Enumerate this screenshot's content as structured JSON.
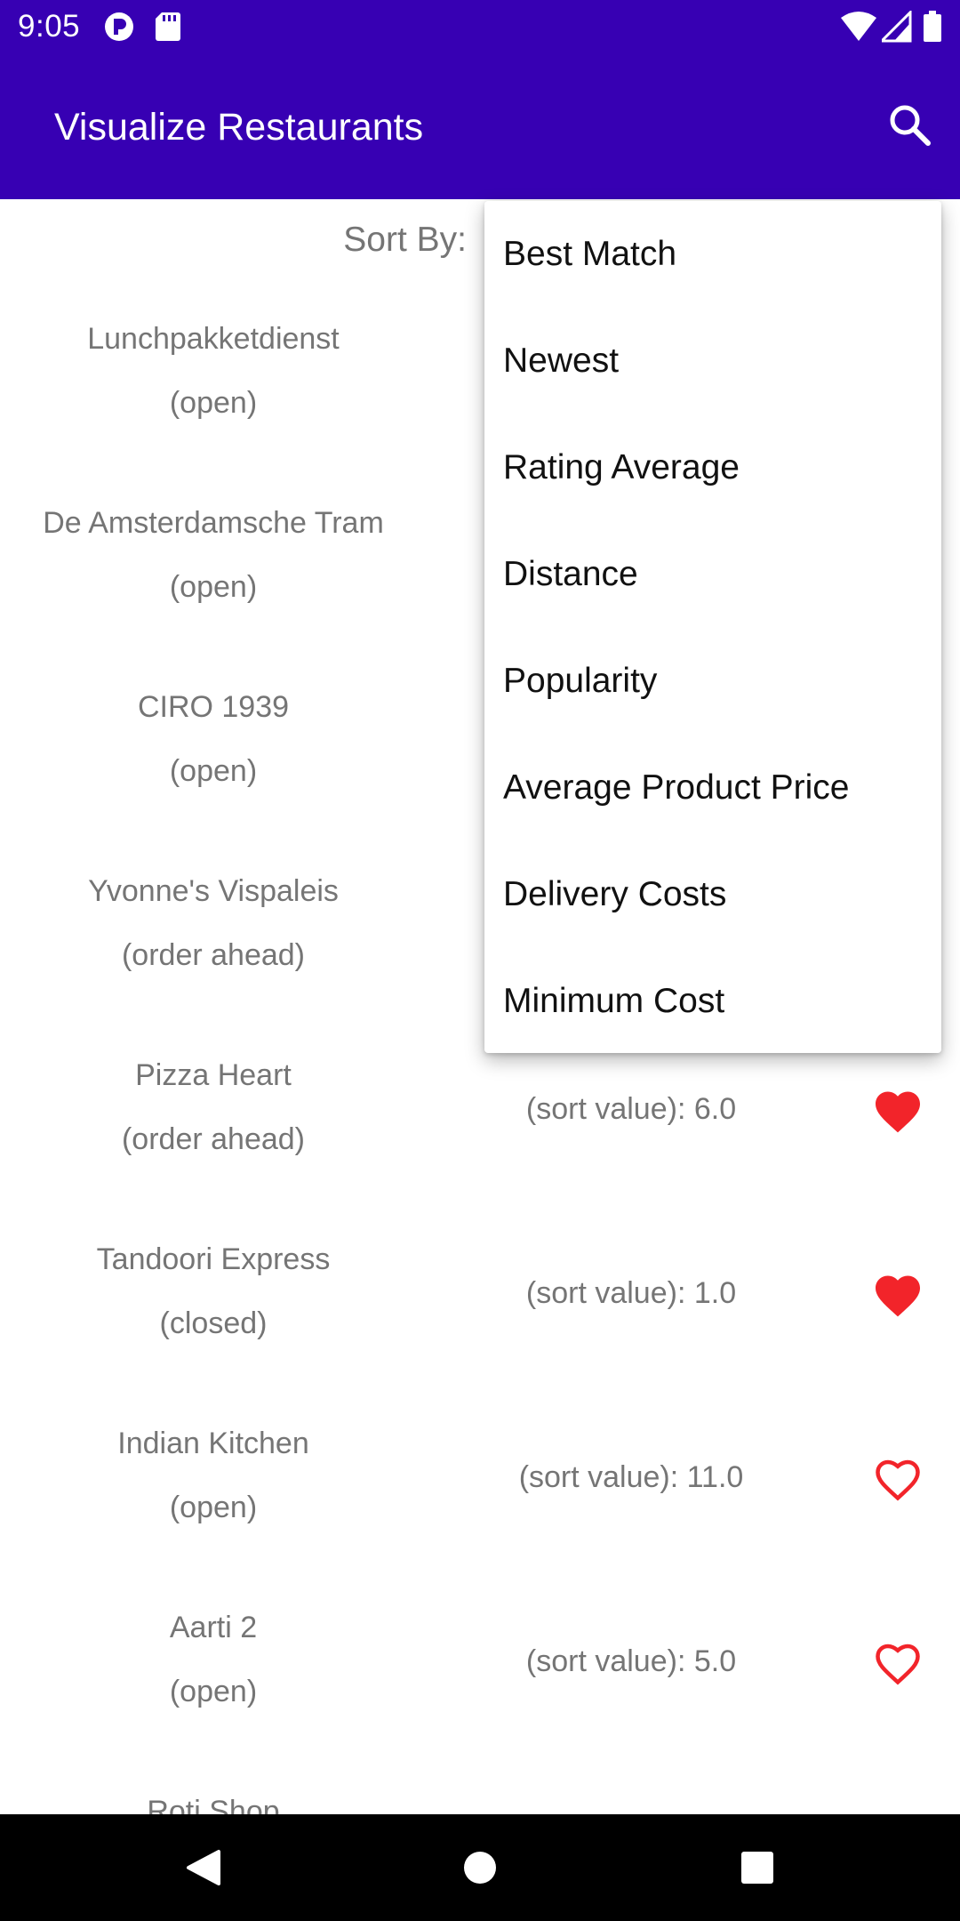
{
  "status_bar": {
    "time": "9:05",
    "icons": [
      "app-notification-icon",
      "sd-card-icon",
      "wifi-icon",
      "signal-icon",
      "battery-icon"
    ]
  },
  "app_bar": {
    "title": "Visualize Restaurants",
    "search_icon": "search-icon",
    "background": "#3700b3"
  },
  "sort": {
    "label": "Sort By:",
    "options": [
      "Best Match",
      "Newest",
      "Rating Average",
      "Distance",
      "Popularity",
      "Average Product Price",
      "Delivery Costs",
      "Minimum Cost"
    ]
  },
  "restaurants": [
    {
      "name": "Lunchpakketdienst",
      "status": "(open)",
      "sort_value": "",
      "favorite": null
    },
    {
      "name": "De Amsterdamsche Tram",
      "status": "(open)",
      "sort_value": "",
      "favorite": null
    },
    {
      "name": "CIRO 1939",
      "status": "(open)",
      "sort_value": "",
      "favorite": null
    },
    {
      "name": "Yvonne's Vispaleis",
      "status": "(order ahead)",
      "sort_value": "",
      "favorite": null
    },
    {
      "name": "Pizza Heart",
      "status": "(order ahead)",
      "sort_value": "(sort value): 6.0",
      "favorite": true
    },
    {
      "name": "Tandoori Express",
      "status": "(closed)",
      "sort_value": "(sort value): 1.0",
      "favorite": true
    },
    {
      "name": "Indian Kitchen",
      "status": "(open)",
      "sort_value": "(sort value): 11.0",
      "favorite": false
    },
    {
      "name": "Aarti 2",
      "status": "(open)",
      "sort_value": "(sort value): 5.0",
      "favorite": false
    },
    {
      "name": "Roti Shop",
      "status": "",
      "sort_value": "",
      "favorite": null
    }
  ],
  "colors": {
    "heart": "#f2242a",
    "text_secondary": "#757575"
  },
  "nav_bar": {
    "back_icon": "back-icon",
    "home_icon": "home-icon",
    "recents_icon": "recents-icon"
  }
}
